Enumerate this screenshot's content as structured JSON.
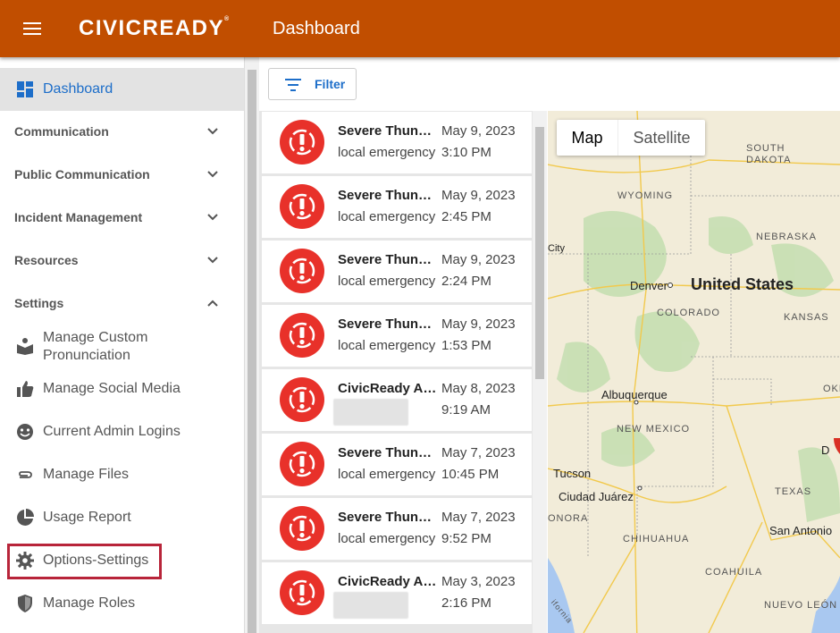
{
  "header": {
    "brand": "CIVICREADY",
    "page_title": "Dashboard"
  },
  "sidebar": {
    "active_item": "Dashboard",
    "sections": [
      {
        "label": "Communication"
      },
      {
        "label": "Public Communication"
      },
      {
        "label": "Incident Management"
      },
      {
        "label": "Resources"
      },
      {
        "label": "Settings"
      }
    ],
    "settings_items": [
      {
        "label": "Manage Custom Pronunciation",
        "line1": "Manage Custom",
        "line2": "Pronunciation",
        "icon": "book-person-icon"
      },
      {
        "label": "Manage Social Media",
        "icon": "thumbs-up-icon"
      },
      {
        "label": "Current Admin Logins",
        "icon": "face-icon"
      },
      {
        "label": "Manage Files",
        "icon": "paperclip-icon"
      },
      {
        "label": "Usage Report",
        "icon": "pie-chart-icon"
      },
      {
        "label": "Options-Settings",
        "icon": "gear-icon"
      },
      {
        "label": "Manage Roles",
        "icon": "shield-icon"
      }
    ]
  },
  "toolbar": {
    "filter_label": "Filter"
  },
  "alerts": [
    {
      "title": "Severe Thunderstorm",
      "desc": "local emergency",
      "date": "May 9, 2023",
      "time": "3:10 PM"
    },
    {
      "title": "Severe Thunderstorm",
      "desc": "local emergency",
      "date": "May 9, 2023",
      "time": "2:45 PM"
    },
    {
      "title": "Severe Thunderstorm",
      "desc": "local emergency",
      "date": "May 9, 2023",
      "time": "2:24 PM"
    },
    {
      "title": "Severe Thunderstorm",
      "desc": "local emergency",
      "date": "May 9, 2023",
      "time": "1:53 PM"
    },
    {
      "title": "CivicReady Alert",
      "desc": "",
      "date": "May 8, 2023",
      "time": "9:19 AM"
    },
    {
      "title": "Severe Thunderstorm",
      "desc": "local emergency",
      "date": "May 7, 2023",
      "time": "10:45 PM"
    },
    {
      "title": "Severe Thunderstorm",
      "desc": "local emergency",
      "date": "May 7, 2023",
      "time": "9:52 PM"
    },
    {
      "title": "CivicReady Alert",
      "desc": "",
      "date": "May 3, 2023",
      "time": "2:16 PM"
    }
  ],
  "map": {
    "toggle": {
      "map": "Map",
      "satellite": "Satellite"
    },
    "labels": {
      "wyoming": "WYOMING",
      "south_dakota_1": "SOUTH",
      "south_dakota_2": "DAKOTA",
      "nebraska": "NEBRASKA",
      "colorado": "COLORADO",
      "kansas": "KANSAS",
      "new_mexico": "NEW MEXICO",
      "texas": "TEXAS",
      "chihuahua": "CHIHUAHUA",
      "coahuila": "COAHUILA",
      "nuevo_leon": "NUEVO LEÓN",
      "sonora": "ONORA",
      "oklahoma": "OKLAHO",
      "country": "United States",
      "denver": "Denver",
      "albuquerque": "Albuquerque",
      "tucson": "Tucson",
      "ciudad_juarez": "Ciudad Juárez",
      "san_antonio": "San Antonio",
      "city_partial": "City",
      "california_partial": "ifornia",
      "dallas_partial": "D"
    }
  },
  "colors": {
    "header": "#c14e00",
    "accent": "#1d6ec9",
    "alert": "#e8312a",
    "highlight": "#b8253a"
  }
}
